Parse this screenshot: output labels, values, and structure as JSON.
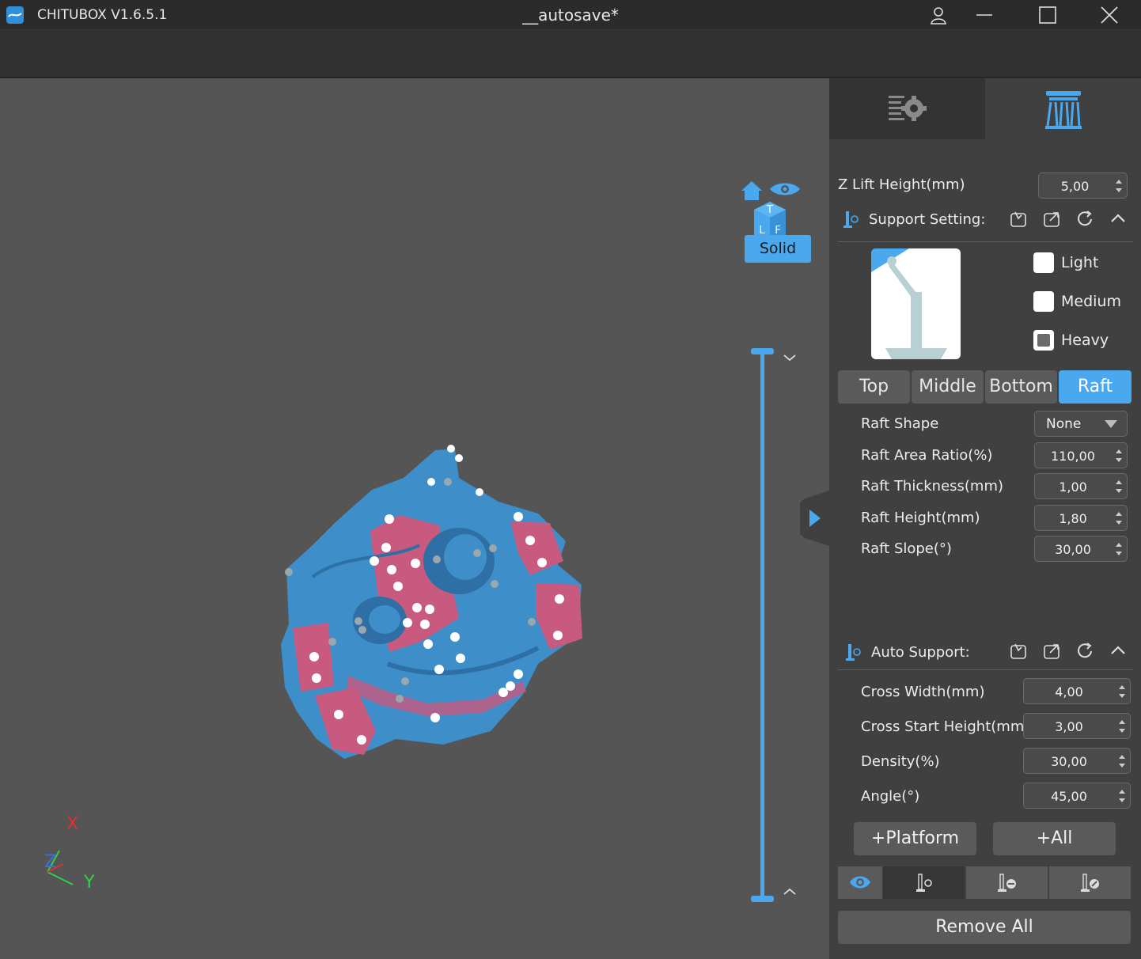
{
  "app": {
    "title": "CHITUBOX V1.6.5.1",
    "document": "__autosave*"
  },
  "viewport": {
    "render_mode": "Solid",
    "axes": {
      "x": "X",
      "y": "Y",
      "z": "Z"
    },
    "cube_faces": {
      "top": "T",
      "left": "L",
      "front": "F"
    }
  },
  "panel": {
    "z_lift": {
      "label": "Z Lift Height(mm)",
      "value": "5,00"
    },
    "support_setting": {
      "title": "Support Setting:",
      "presets": [
        {
          "label": "Light",
          "checked": false
        },
        {
          "label": "Medium",
          "checked": false
        },
        {
          "label": "Heavy",
          "checked": true
        }
      ],
      "tabs": [
        "Top",
        "Middle",
        "Bottom",
        "Raft"
      ],
      "active_tab": "Raft",
      "raft_shape": {
        "label": "Raft Shape",
        "value": "None"
      },
      "fields": [
        {
          "label": "Raft Area Ratio(%)",
          "value": "110,00"
        },
        {
          "label": "Raft Thickness(mm)",
          "value": "1,00"
        },
        {
          "label": "Raft Height(mm)",
          "value": "1,80"
        },
        {
          "label": "Raft Slope(°)",
          "value": "30,00"
        }
      ]
    },
    "auto_support": {
      "title": "Auto Support:",
      "fields": [
        {
          "label": "Cross Width(mm)",
          "value": "4,00"
        },
        {
          "label": "Cross Start Height(mm)",
          "value": "3,00"
        },
        {
          "label": "Density(%)",
          "value": "30,00"
        },
        {
          "label": "Angle(°)",
          "value": "45,00"
        }
      ],
      "platform_button": "+Platform",
      "all_button": "+All",
      "remove_all": "Remove All"
    }
  },
  "colors": {
    "accent": "#4aa8ee",
    "model_blue": "#3d8ec9",
    "model_pink": "#c85a80",
    "viewport_bg": "#555555",
    "panel_bg": "#404040"
  }
}
